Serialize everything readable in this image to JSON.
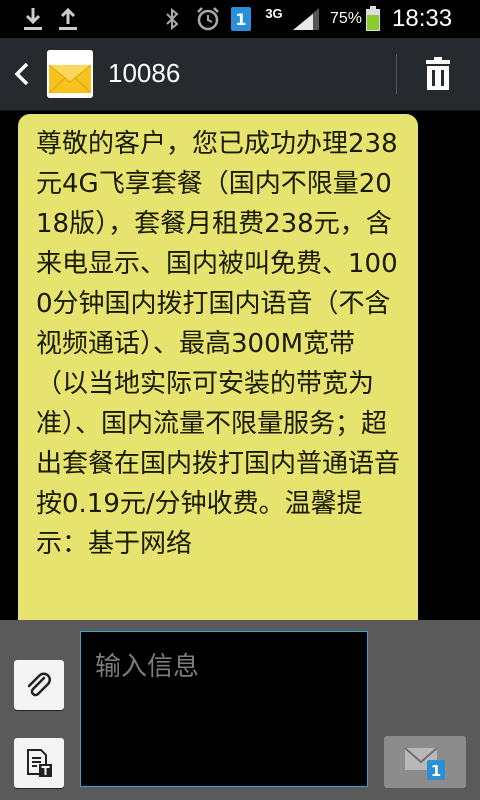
{
  "status_bar": {
    "network": "3G",
    "battery_percent": "75%",
    "sim_slot": "1",
    "time": "18:33",
    "battery_level": 0.75,
    "icons": [
      "download-icon",
      "upload-icon",
      "bluetooth-icon",
      "alarm-icon",
      "sim-icon",
      "signal-icon",
      "battery-icon"
    ]
  },
  "header": {
    "contact": "10086",
    "icons": [
      "back-icon",
      "envelope-avatar-icon",
      "trash-icon"
    ]
  },
  "conversation": {
    "messages": [
      {
        "text": "尊敬的客户，您已成功办理238元4G飞享套餐（国内不限量2018版），套餐月租费238元，含来电显示、国内被叫免费、1000分钟国内拨打国内语音（不含视频通话）、最高300M宽带（以当地实际可安装的带宽为准）、国内流量不限量服务；超出套餐在国内拨打国内普通语音按0.19元/分钟收费。温馨提示：基于网络"
      }
    ]
  },
  "compose": {
    "placeholder": "输入信息",
    "send_badge": "1",
    "icons": [
      "paperclip-icon",
      "template-icon",
      "send-icon"
    ]
  },
  "colors": {
    "bubble": "#e7e36f",
    "header": "#262a2f",
    "compose_bar": "#5a5a5a",
    "input_border": "#3aa0d8",
    "sim_badge": "#2b8fd8",
    "battery": "#8ccc2a"
  }
}
